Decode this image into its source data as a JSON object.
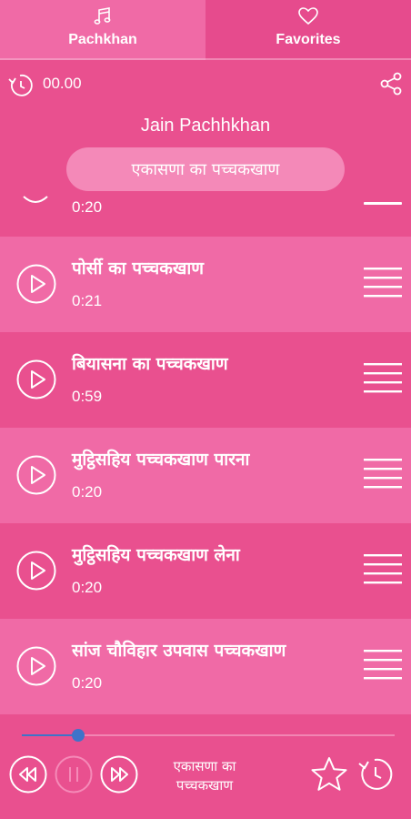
{
  "tabs": [
    {
      "label": "Pachkhan",
      "icon": "music-note-icon",
      "active": true
    },
    {
      "label": "Favorites",
      "icon": "heart-icon",
      "active": false
    }
  ],
  "timer": {
    "value": "00.00",
    "icon": "sleep-timer-icon"
  },
  "share": {
    "icon": "share-icon"
  },
  "app_title": "Jain Pachhkhan",
  "current_track": "एकासणा का पच्चकखाण",
  "partial_item": {
    "duration": "0:20"
  },
  "items": [
    {
      "title": "पोर्सी का पच्चकखाण",
      "duration": "0:21"
    },
    {
      "title": "बियासना का पच्चकखाण",
      "duration": "0:59"
    },
    {
      "title": "मुट्ठिसहिय पच्चकखाण पारना",
      "duration": "0:20"
    },
    {
      "title": "मुट्ठिसहिय पच्चकखाण लेना",
      "duration": "0:20"
    },
    {
      "title": "सांज चौविहार उपवास पच्चकखाण",
      "duration": "0:20"
    }
  ],
  "player": {
    "progress": 0.15,
    "now_playing_line1": "एकासणा का",
    "now_playing_line2": "पच्चकखाण",
    "controls": [
      "rewind-icon",
      "pause-icon",
      "fast-forward-icon",
      "star-icon",
      "sleep-timer-icon"
    ]
  },
  "colors": {
    "background": "#e9508f",
    "row_alt": "#f06aa6",
    "pill": "#f489b8",
    "seek_accent": "#3f73c9"
  }
}
